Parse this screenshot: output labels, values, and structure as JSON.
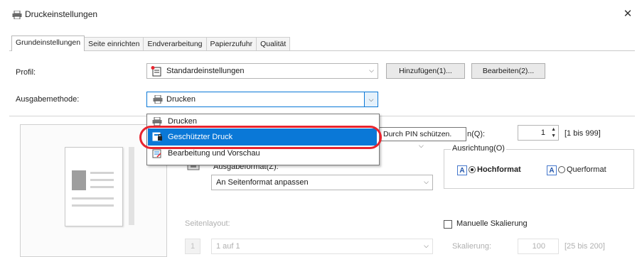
{
  "window": {
    "title": "Druckeinstellungen",
    "close_glyph": "✕"
  },
  "tabs": [
    {
      "label": "Grundeinstellungen",
      "active": true
    },
    {
      "label": "Seite einrichten",
      "active": false
    },
    {
      "label": "Endverarbeitung",
      "active": false
    },
    {
      "label": "Papierzufuhr",
      "active": false
    },
    {
      "label": "Qualität",
      "active": false
    }
  ],
  "profile": {
    "label": "Profil:",
    "value": "Standardeinstellungen",
    "add_button": "Hinzufügen(1)...",
    "edit_button": "Bearbeiten(2)..."
  },
  "output_method": {
    "label": "Ausgabemethode:",
    "value": "Drucken",
    "options": [
      {
        "label": "Drucken",
        "icon": "printer-icon",
        "selected": false
      },
      {
        "label": "Geschützter Druck",
        "icon": "secure-print-icon",
        "selected": true
      },
      {
        "label": "Bearbeitung und Vorschau",
        "icon": "edit-preview-icon",
        "selected": false
      }
    ]
  },
  "tooltip": {
    "text": "Durch PIN schützen."
  },
  "copies": {
    "label_suffix": "n(Q):",
    "value": "1",
    "range": "[1 bis 999]"
  },
  "orientation": {
    "label": "Ausrichtung(O)",
    "portrait": "Hochformat",
    "landscape": "Querformat",
    "selected": "Hochformat"
  },
  "output_size": {
    "label": "Ausgabeformat(Z):",
    "value": "An Seitenformat anpassen"
  },
  "page_layout": {
    "label": "Seitenlayout:",
    "value": "1 auf 1",
    "number": "1"
  },
  "manual_scaling": {
    "label": "Manuelle Skalierung",
    "checked": false,
    "sub_label": "Skalierung:",
    "value": "100",
    "range": "[25 bis 200]"
  },
  "colors": {
    "accent": "#0a78d7",
    "highlight_ring": "#e8242e"
  }
}
